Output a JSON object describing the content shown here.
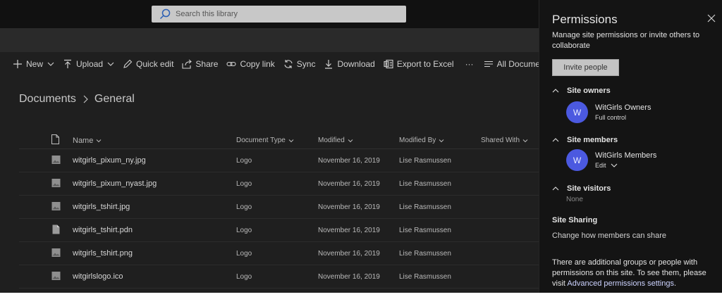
{
  "search": {
    "placeholder": "Search this library"
  },
  "commands": {
    "new": "New",
    "upload": "Upload",
    "quick_edit": "Quick edit",
    "share": "Share",
    "copy_link": "Copy link",
    "sync": "Sync",
    "download": "Download",
    "export": "Export to Excel",
    "more": "···",
    "view": "All Documents"
  },
  "breadcrumb": {
    "root": "Documents",
    "current": "General"
  },
  "table": {
    "headers": {
      "name": "Name",
      "type": "Document Type",
      "modified": "Modified",
      "modified_by": "Modified By",
      "shared_with": "Shared With"
    },
    "rows": [
      {
        "name": "witgirls_pixum_ny.jpg",
        "type": "Logo",
        "modified": "November 16, 2019",
        "by": "Lise Rasmussen",
        "icon": "image-file-icon"
      },
      {
        "name": "witgirls_pixum_nyast.jpg",
        "type": "Logo",
        "modified": "November 16, 2019",
        "by": "Lise Rasmussen",
        "icon": "image-file-icon"
      },
      {
        "name": "witgirls_tshirt.jpg",
        "type": "Logo",
        "modified": "November 16, 2019",
        "by": "Lise Rasmussen",
        "icon": "image-file-icon"
      },
      {
        "name": "witgirls_tshirt.pdn",
        "type": "Logo",
        "modified": "November 16, 2019",
        "by": "Lise Rasmussen",
        "icon": "generic-file-icon"
      },
      {
        "name": "witgirls_tshirt.png",
        "type": "Logo",
        "modified": "November 16, 2019",
        "by": "Lise Rasmussen",
        "icon": "image-file-icon"
      },
      {
        "name": "witgirlslogo.ico",
        "type": "Logo",
        "modified": "November 16, 2019",
        "by": "Lise Rasmussen",
        "icon": "image-file-icon"
      }
    ]
  },
  "panel": {
    "title": "Permissions",
    "description": "Manage site permissions or invite others to collaborate",
    "invite": "Invite people",
    "owners": {
      "label": "Site owners",
      "avatar": "W",
      "name": "WitGirls Owners",
      "role": "Full control"
    },
    "members": {
      "label": "Site members",
      "avatar": "W",
      "name": "WitGirls Members",
      "role": "Edit"
    },
    "visitors": {
      "label": "Site visitors",
      "none": "None"
    },
    "sharing": {
      "label": "Site Sharing",
      "link": "Change how members can share"
    },
    "additional": "There are additional groups or people with permissions on this site. To see them, please visit",
    "advanced": "Advanced permissions settings",
    "period": "."
  },
  "colors": {
    "accent": "#4b59e0",
    "panel_bg": "#141414",
    "app_bg": "#1f1f1f"
  }
}
